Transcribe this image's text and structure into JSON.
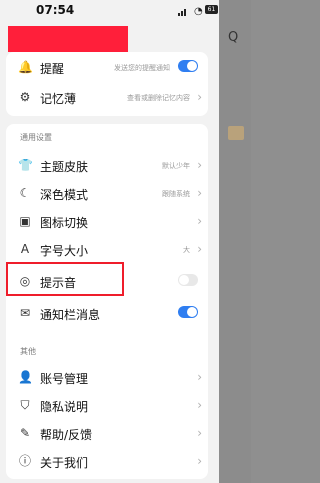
{
  "status": {
    "time": "07:54",
    "battery": "61"
  },
  "top_items": [
    {
      "label": "提醒",
      "hint": "发送您的提醒通知",
      "icon": "bell-icon",
      "toggle_on": true
    },
    {
      "label": "记忆薄",
      "hint": "查看或删除记忆内容",
      "icon": "gear-icon",
      "toggle_on": null
    }
  ],
  "general": {
    "section_title": "通用设置",
    "items": [
      {
        "label": "主题皮肤",
        "hint": "默认少年",
        "icon": "shirt-icon"
      },
      {
        "label": "深色模式",
        "hint": "跟随系统",
        "icon": "moon-icon"
      },
      {
        "label": "图标切换",
        "hint": "",
        "icon": "app-icon"
      },
      {
        "label": "字号大小",
        "hint": "大",
        "icon": "font-size-icon"
      },
      {
        "label": "提示音",
        "hint": "",
        "icon": "sound-icon",
        "toggle_on": false
      },
      {
        "label": "通知栏消息",
        "hint": "",
        "icon": "mail-icon",
        "toggle_on": true
      }
    ]
  },
  "other": {
    "section_title": "其他",
    "items": [
      {
        "label": "账号管理",
        "icon": "user-icon"
      },
      {
        "label": "隐私说明",
        "icon": "shield-icon"
      },
      {
        "label": "帮助/反馈",
        "icon": "feedback-icon"
      },
      {
        "label": "关于我们",
        "icon": "info-icon"
      }
    ]
  },
  "colors": {
    "toggle_on": "#2f7ef1",
    "highlight": "#ef1d2b",
    "redaction": "#ff1f3a"
  }
}
